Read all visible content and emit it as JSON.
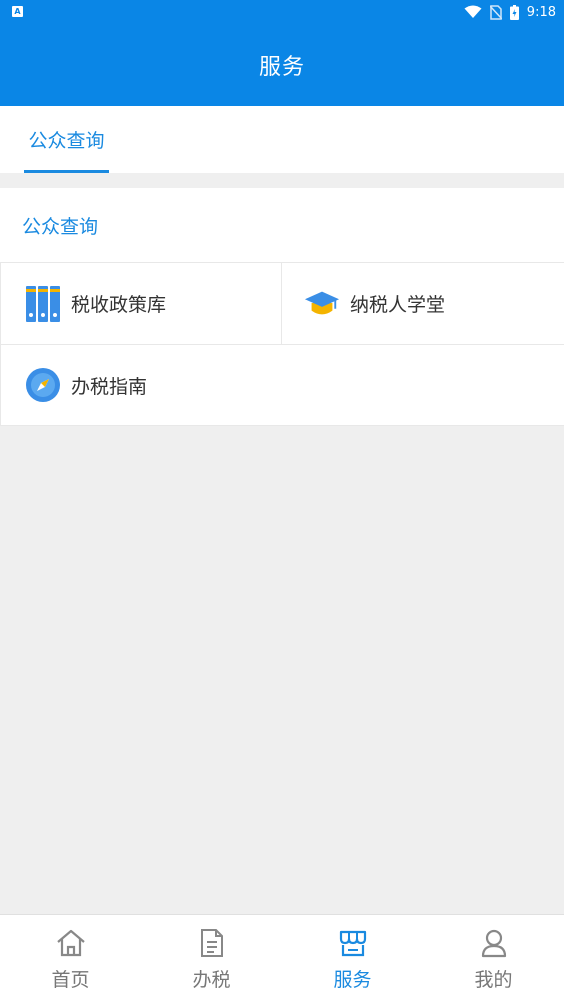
{
  "status_bar": {
    "app_badge": "A",
    "time": "9:18"
  },
  "header": {
    "title": "服务"
  },
  "tabs": [
    {
      "label": "公众查询",
      "active": true
    }
  ],
  "section": {
    "title": "公众查询",
    "items": [
      {
        "label": "税收政策库",
        "icon": "books-icon"
      },
      {
        "label": "纳税人学堂",
        "icon": "graduation-cap-icon"
      },
      {
        "label": "办税指南",
        "icon": "compass-icon"
      }
    ]
  },
  "bottom_nav": [
    {
      "label": "首页",
      "icon": "home-icon",
      "active": false
    },
    {
      "label": "办税",
      "icon": "document-icon",
      "active": false
    },
    {
      "label": "服务",
      "icon": "store-icon",
      "active": true
    },
    {
      "label": "我的",
      "icon": "user-icon",
      "active": false
    }
  ],
  "colors": {
    "primary": "#0a86e6",
    "accent": "#1a8ae0",
    "background": "#efefef"
  }
}
